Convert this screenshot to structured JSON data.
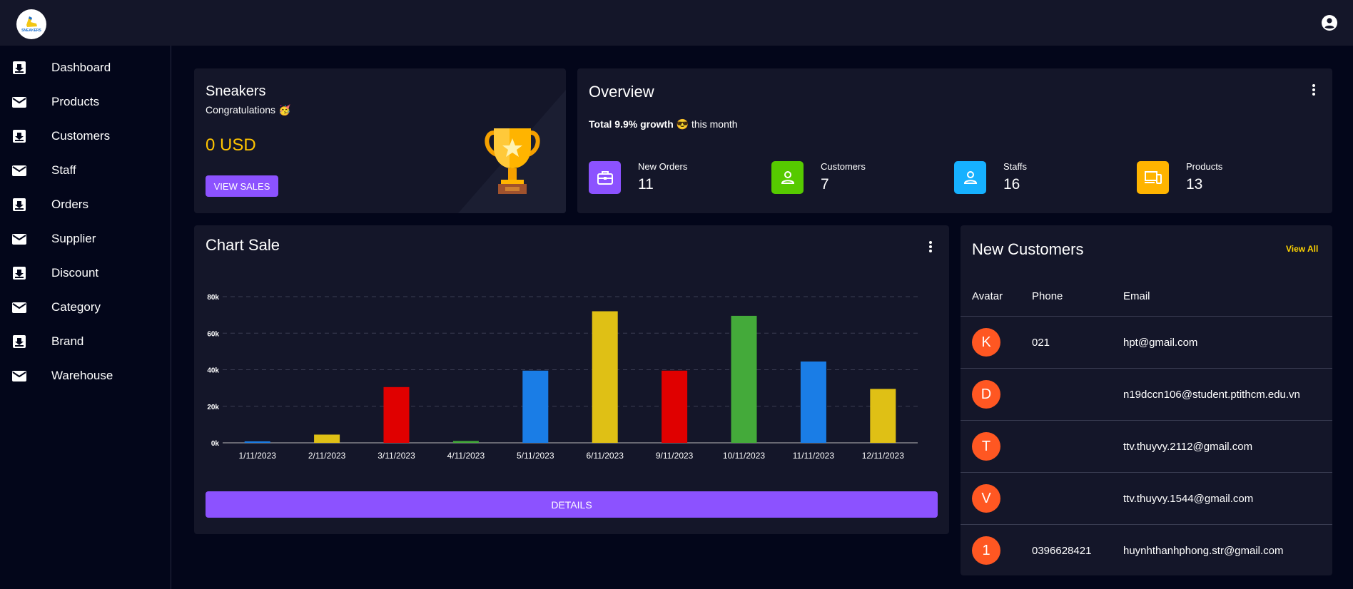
{
  "app": {
    "logo_text": "SNEAKERS"
  },
  "topbar": {
    "account_icon": "account-circle-icon"
  },
  "sidebar": {
    "items": [
      {
        "label": "Dashboard",
        "icon": "inbox-download-icon"
      },
      {
        "label": "Products",
        "icon": "mail-icon"
      },
      {
        "label": "Customers",
        "icon": "inbox-download-icon"
      },
      {
        "label": "Staff",
        "icon": "mail-icon"
      },
      {
        "label": "Orders",
        "icon": "inbox-download-icon"
      },
      {
        "label": "Supplier",
        "icon": "mail-icon"
      },
      {
        "label": "Discount",
        "icon": "inbox-download-icon"
      },
      {
        "label": "Category",
        "icon": "mail-icon"
      },
      {
        "label": "Brand",
        "icon": "inbox-download-icon"
      },
      {
        "label": "Warehouse",
        "icon": "mail-icon"
      }
    ]
  },
  "sales_card": {
    "title": "Sneakers",
    "subtitle": "Congratulations",
    "emoji": "🥳",
    "amount": "0 USD",
    "button": "VIEW SALES",
    "amount_color": "#ffc400"
  },
  "overview": {
    "title": "Overview",
    "growth_bold": "Total 9.9% growth",
    "growth_emoji": "😎",
    "growth_suffix": "this month",
    "stats": [
      {
        "label": "New Orders",
        "value": "11",
        "color": "#8c52ff",
        "icon": "briefcase-icon"
      },
      {
        "label": "Customers",
        "value": "7",
        "color": "#56ca00",
        "icon": "person-icon"
      },
      {
        "label": "Staffs",
        "value": "16",
        "color": "#16b1ff",
        "icon": "person-icon"
      },
      {
        "label": "Products",
        "value": "13",
        "color": "#ffb400",
        "icon": "devices-icon"
      }
    ]
  },
  "chart_card": {
    "title": "Chart Sale",
    "button": "DETAILS"
  },
  "chart_data": {
    "type": "bar",
    "categories": [
      "1/11/2023",
      "2/11/2023",
      "3/11/2023",
      "4/11/2023",
      "5/11/2023",
      "6/11/2023",
      "9/11/2023",
      "10/11/2023",
      "11/11/2023",
      "12/11/2023"
    ],
    "values": [
      800,
      4500,
      30500,
      1000,
      39500,
      72000,
      39500,
      69500,
      44500,
      29500
    ],
    "colors": [
      "#1a7de6",
      "#dfc015",
      "#e00000",
      "#44aa3a",
      "#1a7de6",
      "#dfc015",
      "#e00000",
      "#44aa3a",
      "#1a7de6",
      "#dfc015"
    ],
    "yticks": [
      0,
      20000,
      40000,
      60000,
      80000
    ],
    "ytick_labels": [
      "0k",
      "20k",
      "40k",
      "60k",
      "80k"
    ],
    "ylim": [
      0,
      80000
    ],
    "grid": true
  },
  "customers": {
    "title": "New Customers",
    "view_all": "View All",
    "headers": {
      "avatar": "Avatar",
      "phone": "Phone",
      "email": "Email"
    },
    "rows": [
      {
        "initial": "K",
        "phone": "021",
        "email": "hpt@gmail.com"
      },
      {
        "initial": "D",
        "phone": "",
        "email": "n19dccn106@student.ptithcm.edu.vn"
      },
      {
        "initial": "T",
        "phone": "",
        "email": "ttv.thuyvy.2112@gmail.com"
      },
      {
        "initial": "V",
        "phone": "",
        "email": "ttv.thuyvy.1544@gmail.com"
      },
      {
        "initial": "1",
        "phone": "0396628421",
        "email": "huynhthanhphong.str@gmail.com"
      }
    ],
    "avatar_color": "#ff5722"
  }
}
